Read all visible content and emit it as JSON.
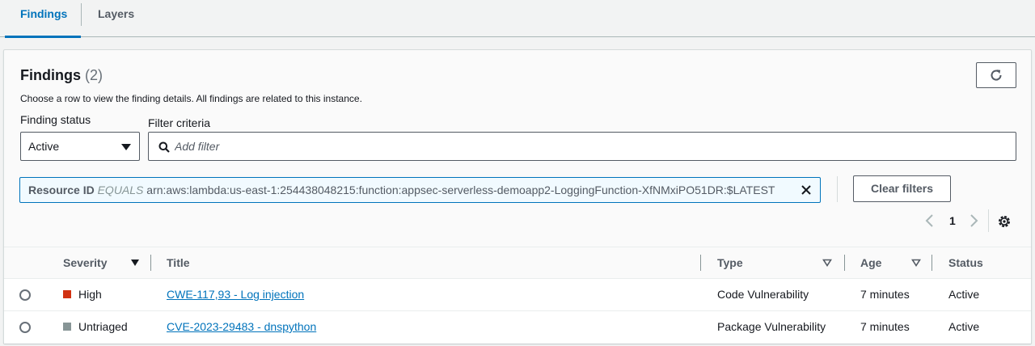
{
  "tabs": [
    {
      "label": "Findings",
      "active": true
    },
    {
      "label": "Layers",
      "active": false
    }
  ],
  "panel": {
    "title": "Findings",
    "count": "(2)",
    "description": "Choose a row to view the finding details. All findings are related to this instance.",
    "refresh_icon": "refresh-icon"
  },
  "filters": {
    "status_label": "Finding status",
    "status_value": "Active",
    "criteria_label": "Filter criteria",
    "criteria_placeholder": "Add filter",
    "token": {
      "key": "Resource ID",
      "operator": "EQUALS",
      "value": "arn:aws:lambda:us-east-1:254438048215:function:appsec-serverless-demoapp2-LoggingFunction-XfNMxiPO51DR:$LATEST"
    },
    "clear_label": "Clear filters"
  },
  "pagination": {
    "current_page": "1"
  },
  "table": {
    "columns": [
      "Severity",
      "Title",
      "Type",
      "Age",
      "Status"
    ],
    "rows": [
      {
        "severity": "High",
        "severity_color": "#d13212",
        "title": "CWE-117,93 - Log injection",
        "type": "Code Vulnerability",
        "age": "7 minutes",
        "status": "Active"
      },
      {
        "severity": "Untriaged",
        "severity_color": "#879596",
        "title": "CVE-2023-29483 - dnspython",
        "type": "Package Vulnerability",
        "age": "7 minutes",
        "status": "Active"
      }
    ]
  },
  "colors": {
    "accent": "#0073bb",
    "high": "#d13212",
    "untriaged": "#879596"
  }
}
